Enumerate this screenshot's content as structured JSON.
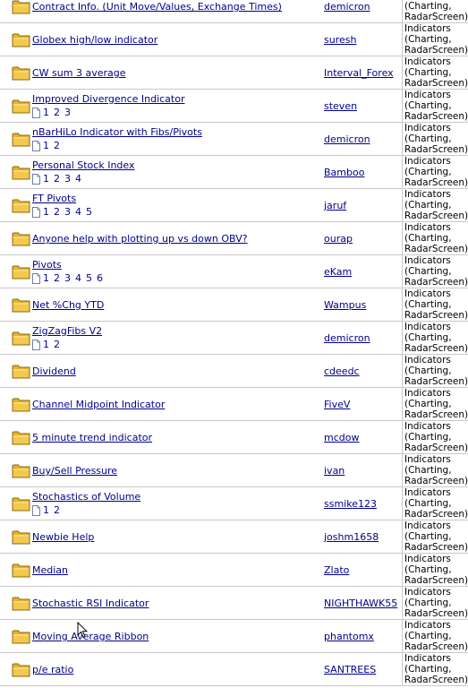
{
  "forum_line": [
    "Indicators",
    "(Charting,",
    "RadarScreen)"
  ],
  "colors": {
    "link": "#00008b",
    "border": "#c8c8c8",
    "folder": "#f2c94c"
  },
  "icons": {
    "folder": "folder-icon",
    "page": "page-icon",
    "cursor": "mouse-pointer-icon"
  },
  "topics": [
    {
      "title": "Contract Info. (Unit Move/Values, Exchange Times)",
      "author": "demicron",
      "pages": []
    },
    {
      "title": "Globex high/low indicator",
      "author": "suresh",
      "pages": []
    },
    {
      "title": "CW sum 3 average",
      "author": "Interval_Forex",
      "pages": []
    },
    {
      "title": "Improved Divergence Indicator",
      "author": "steven",
      "pages": [
        "1",
        "2",
        "3"
      ]
    },
    {
      "title": "nBarHiLo Indicator with Fibs/Pivots",
      "author": "demicron",
      "pages": [
        "1",
        "2"
      ]
    },
    {
      "title": "Personal Stock Index",
      "author": "Bamboo",
      "pages": [
        "1",
        "2",
        "3",
        "4"
      ]
    },
    {
      "title": "FT Pivots",
      "author": "jaruf",
      "pages": [
        "1",
        "2",
        "3",
        "4",
        "5"
      ]
    },
    {
      "title": "Anyone help with plotting up vs down OBV?",
      "author": "ourap",
      "pages": []
    },
    {
      "title": "Pivots",
      "author": "eKam",
      "pages": [
        "1",
        "2",
        "3",
        "4",
        "5",
        "6"
      ]
    },
    {
      "title": "Net %Chg YTD",
      "author": "Wampus",
      "pages": []
    },
    {
      "title": "ZigZagFibs V2",
      "author": "demicron",
      "pages": [
        "1",
        "2"
      ]
    },
    {
      "title": "Dividend",
      "author": "cdeedc",
      "pages": []
    },
    {
      "title": "Channel Midpoint Indicator",
      "author": "FiveV",
      "pages": []
    },
    {
      "title": "5 minute trend indicator",
      "author": "mcdow",
      "pages": []
    },
    {
      "title": "Buy/Sell Pressure",
      "author": "ivan",
      "pages": []
    },
    {
      "title": "Stochastics of Volume",
      "author": "ssmike123",
      "pages": [
        "1",
        "2"
      ]
    },
    {
      "title": "Newbie Help",
      "author": "joshm1658",
      "pages": []
    },
    {
      "title": "Median",
      "author": "Zlato",
      "pages": []
    },
    {
      "title": "Stochastic RSI Indicator",
      "author": "NIGHTHAWK55",
      "pages": []
    },
    {
      "title": "Moving Average Ribbon",
      "author": "phantomx",
      "pages": []
    },
    {
      "title": "p/e ratio",
      "author": "SANTREES",
      "pages": []
    }
  ]
}
